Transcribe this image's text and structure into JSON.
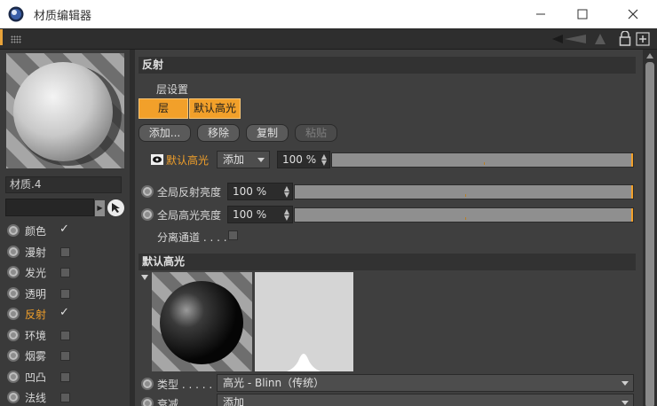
{
  "window": {
    "title": "材质编辑器"
  },
  "material": {
    "name": "材质.4"
  },
  "channels": [
    {
      "label": "颜色",
      "checked": true,
      "active": false
    },
    {
      "label": "漫射",
      "checked": false,
      "active": false
    },
    {
      "label": "发光",
      "checked": false,
      "active": false
    },
    {
      "label": "透明",
      "checked": false,
      "active": false
    },
    {
      "label": "反射",
      "checked": true,
      "active": true
    },
    {
      "label": "环境",
      "checked": false,
      "active": false
    },
    {
      "label": "烟雾",
      "checked": false,
      "active": false
    },
    {
      "label": "凹凸",
      "checked": false,
      "active": false
    },
    {
      "label": "法线",
      "checked": false,
      "active": false
    }
  ],
  "reflection": {
    "header": "反射",
    "layer_settings": "层设置",
    "tab_layer": "层",
    "tab_default_spec": "默认高光",
    "btn_add": "添加...",
    "btn_remove": "移除",
    "btn_copy": "复制",
    "btn_paste": "粘贴",
    "layer_name": "默认高光",
    "blend_mode": "添加",
    "layer_opacity": "100 %",
    "global_reflect_label": "全局反射亮度",
    "global_reflect_value": "100 %",
    "global_spec_label": "全局高光亮度",
    "global_spec_value": "100 %",
    "separate_pass_label": "分离通道 . . . ."
  },
  "default_spec": {
    "header": "默认高光",
    "type_label": "类型 . . . . .",
    "type_value": "高光 - Blinn（传统）",
    "atten_label": "衰减",
    "atten_value": "添加"
  },
  "colors": {
    "accent": "#f2a02a",
    "panel": "#3f3f3f",
    "header": "#323232"
  }
}
